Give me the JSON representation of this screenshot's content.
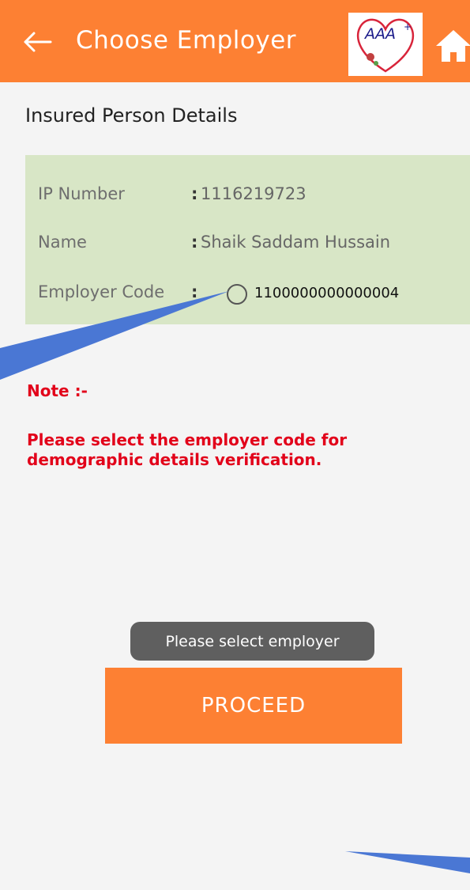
{
  "app_bar": {
    "title": "Choose Employer",
    "logo_text": "AAA",
    "logo_sup": "+",
    "back_icon": "arrow-left-icon",
    "home_icon": "home-icon"
  },
  "section": {
    "title": "Insured Person Details"
  },
  "details": {
    "ip_number_label": "IP Number",
    "ip_number_value": "1116219723",
    "name_label": "Name",
    "name_value": "Shaik Saddam Hussain",
    "employer_code_label": "Employer Code",
    "employer_code_value": "1100000000000004",
    "colon": ":"
  },
  "note": {
    "title": "Note :-",
    "text": "Please select the employer code for demographic details verification."
  },
  "toast": {
    "text": "Please select employer"
  },
  "proceed": {
    "label": "PROCEED"
  },
  "colors": {
    "accent": "#fd8033",
    "card": "#d8e6c6",
    "note": "#e2001a",
    "annotation": "#4a77d4"
  }
}
